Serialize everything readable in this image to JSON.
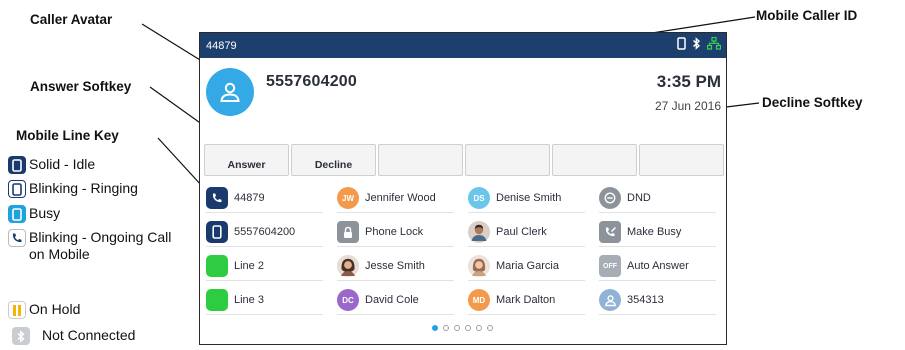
{
  "callouts": {
    "caller_avatar": "Caller Avatar",
    "answer_softkey": "Answer Softkey",
    "mobile_line_key": "Mobile Line Key",
    "mobile_caller_id": "Mobile Caller ID",
    "decline_softkey": "Decline Softkey"
  },
  "legend": [
    {
      "icon": "phone-solid-icon",
      "text": "Solid - Idle"
    },
    {
      "icon": "phone-outline-icon",
      "text": "Blinking - Ringing"
    },
    {
      "icon": "phone-busy-icon",
      "text": "Busy"
    },
    {
      "icon": "handset-icon",
      "text": "Blinking - Ongoing Call on Mobile"
    },
    {
      "icon": "pause-icon",
      "text": "On Hold"
    },
    {
      "icon": "bluetooth-icon",
      "text": "Not Connected"
    }
  ],
  "screen": {
    "status": {
      "extension": "44879",
      "icons": [
        "mobile-icon",
        "bluetooth-icon",
        "network-icon"
      ]
    },
    "call": {
      "caller_id": "5557604200",
      "time": "3:35 PM",
      "date": "27 Jun 2016"
    },
    "softkeys": [
      "Answer",
      "Decline",
      "",
      "",
      "",
      ""
    ],
    "line_keys": [
      [
        {
          "icon": "handset-icon",
          "initials": "",
          "label": "44879",
          "color": "#1a3a6e"
        },
        {
          "icon": "contact-initials-icon",
          "initials": "JW",
          "label": "Jennifer Wood",
          "color": "#f39a4c"
        },
        {
          "icon": "contact-initials-icon",
          "initials": "DS",
          "label": "Denise Smith",
          "color": "#6cc6ea"
        },
        {
          "icon": "dnd-icon",
          "initials": "",
          "label": "DND",
          "color": "#8d939b"
        }
      ],
      [
        {
          "icon": "mobile-line-icon",
          "initials": "",
          "label": "5557604200",
          "color": "#1a3a6e"
        },
        {
          "icon": "lock-icon",
          "initials": "",
          "label": "Phone Lock",
          "color": "#8d939b"
        },
        {
          "icon": "contact-photo-icon",
          "initials": "",
          "label": "Paul Clerk",
          "color": "#7a5a44"
        },
        {
          "icon": "make-busy-icon",
          "initials": "",
          "label": "Make Busy",
          "color": "#8d939b"
        }
      ],
      [
        {
          "icon": "line-green-icon",
          "initials": "",
          "label": "Line 2",
          "color": "#2ecc40"
        },
        {
          "icon": "contact-photo-icon",
          "initials": "",
          "label": "Jesse Smith",
          "color": "#6b4a3a"
        },
        {
          "icon": "contact-photo-icon",
          "initials": "",
          "label": "Maria Garcia",
          "color": "#9b6b4e"
        },
        {
          "icon": "auto-answer-icon",
          "initials": "OFF",
          "label": "Auto Answer",
          "color": "#a7adb4"
        }
      ],
      [
        {
          "icon": "line-green-icon",
          "initials": "",
          "label": "Line 3",
          "color": "#2ecc40"
        },
        {
          "icon": "contact-initials-icon",
          "initials": "DC",
          "label": "David Cole",
          "color": "#9a68c8"
        },
        {
          "icon": "contact-initials-icon",
          "initials": "MD",
          "label": "Mark Dalton",
          "color": "#f39a4c"
        },
        {
          "icon": "contact-avatar-icon",
          "initials": "",
          "label": "354313",
          "color": "#8fb2d6"
        }
      ]
    ],
    "pagination": {
      "pages": 6,
      "current": 1
    }
  },
  "colors": {
    "status_bar": "#1c3f6e",
    "accent": "#1fa3e0",
    "avatar": "#35a9e6",
    "line_green": "#2ecc40"
  }
}
